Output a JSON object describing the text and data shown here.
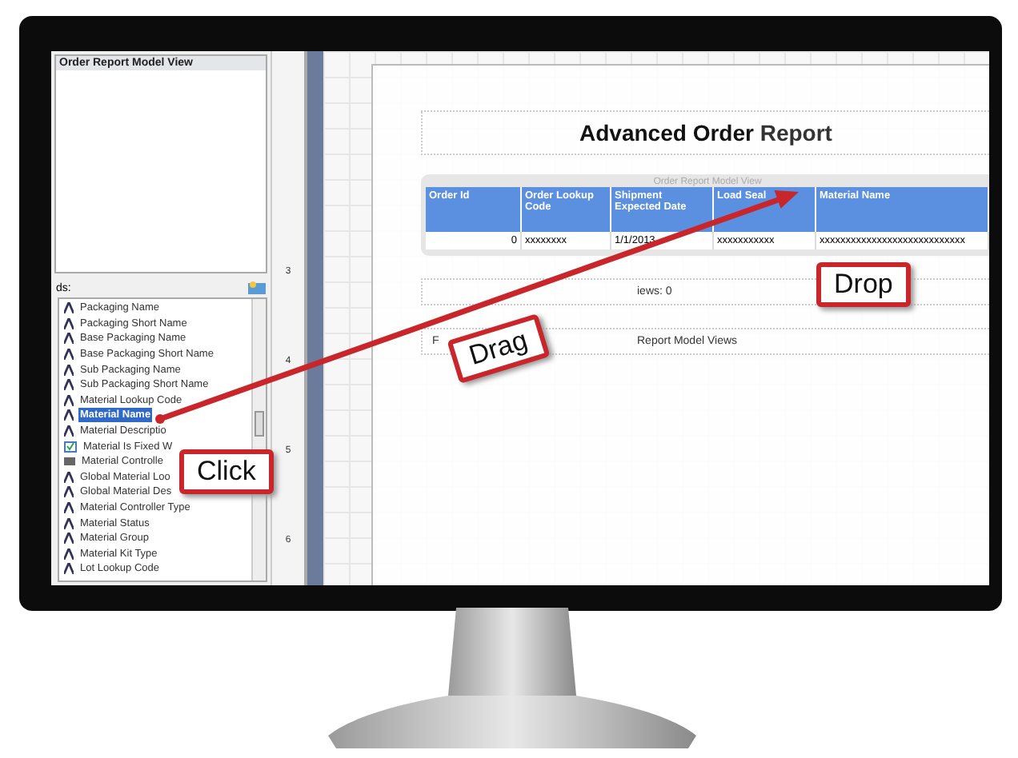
{
  "left_panel": {
    "title": "Order Report Model View",
    "fields_label": "ds:",
    "fields": [
      {
        "label": "Packaging Name",
        "kind": "text",
        "selected": false
      },
      {
        "label": "Packaging Short Name",
        "kind": "text",
        "selected": false
      },
      {
        "label": "Base Packaging Name",
        "kind": "text",
        "selected": false
      },
      {
        "label": "Base Packaging Short Name",
        "kind": "text",
        "selected": false
      },
      {
        "label": "Sub Packaging Name",
        "kind": "text",
        "selected": false
      },
      {
        "label": "Sub Packaging Short Name",
        "kind": "text",
        "selected": false
      },
      {
        "label": "Material Lookup Code",
        "kind": "text",
        "selected": false
      },
      {
        "label": "Material Name",
        "kind": "text",
        "selected": true
      },
      {
        "label": "Material Descriptio",
        "kind": "text",
        "selected": false
      },
      {
        "label": "Material Is Fixed W",
        "kind": "bool",
        "selected": false
      },
      {
        "label": "Material Controlle",
        "kind": "number",
        "selected": false
      },
      {
        "label": "Global Material Loo",
        "kind": "text",
        "selected": false
      },
      {
        "label": "Global Material Des",
        "kind": "text",
        "selected": false
      },
      {
        "label": "Material Controller Type",
        "kind": "text",
        "selected": false
      },
      {
        "label": "Material Status",
        "kind": "text",
        "selected": false
      },
      {
        "label": "Material Group",
        "kind": "text",
        "selected": false
      },
      {
        "label": "Material Kit Type",
        "kind": "text",
        "selected": false
      },
      {
        "label": "Lot Lookup Code",
        "kind": "text",
        "selected": false
      }
    ]
  },
  "ruler": {
    "labels": [
      "3",
      "4",
      "5",
      "6"
    ]
  },
  "report": {
    "title_bold": "Advanced Order",
    "title_rest": "Report",
    "table_caption": "Order Report Model View",
    "columns": [
      "Order Id",
      "Order Lookup Code",
      "Shipment Expected Date",
      "Load Seal",
      "Material Name"
    ],
    "row": [
      "0",
      "xxxxxxxx",
      "1/1/2013",
      "xxxxxxxxxxx",
      "xxxxxxxxxxxxxxxxxxxxxxxxxxxx"
    ],
    "footer_lines": [
      {
        "right": "iews: 0"
      },
      {
        "left": "F",
        "right": "Report Model Views"
      }
    ]
  },
  "callouts": [
    {
      "text": "Click",
      "kind": "click"
    },
    {
      "text": "Drag",
      "kind": "drag"
    },
    {
      "text": "Drop",
      "kind": "drop"
    }
  ]
}
